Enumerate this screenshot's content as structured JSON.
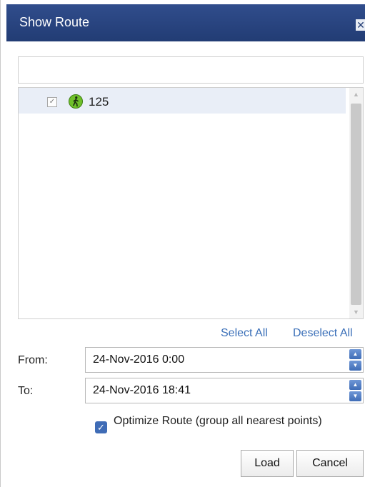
{
  "dialog": {
    "title": "Show Route",
    "close_glyph": "✕"
  },
  "search": {
    "value": "",
    "placeholder": ""
  },
  "tree": {
    "items": [
      {
        "label": "125",
        "checked": true,
        "icon": "walking-person-icon",
        "icon_color": "#6fc02a"
      }
    ]
  },
  "selection": {
    "select_all": "Select All",
    "deselect_all": "Deselect All"
  },
  "from": {
    "label": "From:",
    "value": "24-Nov-2016 0:00"
  },
  "to": {
    "label": "To:",
    "value": "24-Nov-2016 18:41"
  },
  "optimize": {
    "checked": true,
    "label": "Optimize Route (group all nearest points)"
  },
  "buttons": {
    "load": "Load",
    "cancel": "Cancel"
  },
  "colors": {
    "title_bar": "#223c74",
    "link": "#3a6fb8",
    "selected_row": "#e9eef7",
    "spinner": "#3f6cb6"
  }
}
